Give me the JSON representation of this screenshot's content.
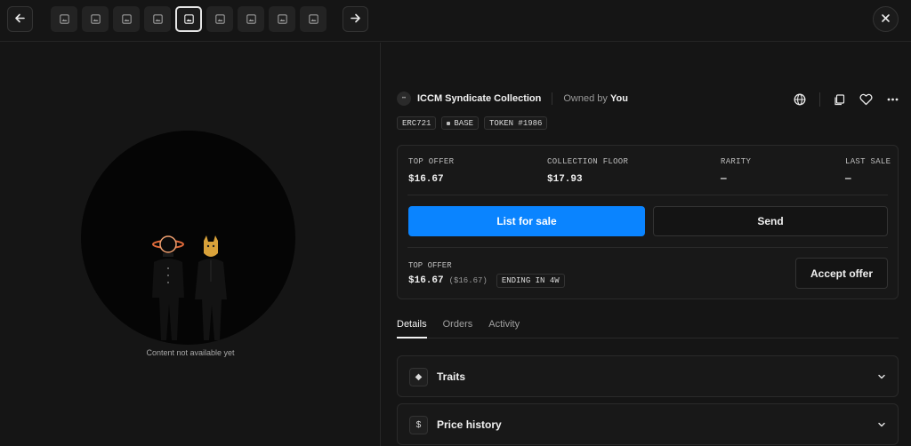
{
  "toolbar": {
    "prev_icon": "arrow-left-icon",
    "next_icon": "arrow-right-icon",
    "close_icon": "close-icon",
    "thumbnail_count": 9,
    "active_thumbnail_index": 4
  },
  "left": {
    "caption": "Content not available yet"
  },
  "header": {
    "collection_name": "ICCM Syndicate Collection",
    "owned_prefix": "Owned by",
    "owned_by": "You",
    "action_icons": [
      "globe-icon",
      "copy-icon",
      "heart-icon",
      "more-icon"
    ]
  },
  "tags": {
    "standard": "ERC721",
    "chain": "BASE",
    "token": "TOKEN #1986"
  },
  "stats": {
    "top_offer_label": "TOP OFFER",
    "top_offer_value": "$16.67",
    "floor_label": "COLLECTION FLOOR",
    "floor_value": "$17.93",
    "rarity_label": "RARITY",
    "rarity_value": "—",
    "last_sale_label": "LAST SALE",
    "last_sale_value": "—"
  },
  "actions": {
    "list_label": "List for sale",
    "send_label": "Send"
  },
  "offer": {
    "label": "TOP OFFER",
    "price": "$16.67",
    "usd": "($16.67)",
    "ending": "ENDING IN 4W",
    "accept_label": "Accept offer"
  },
  "tabs": [
    {
      "label": "Details",
      "active": true
    },
    {
      "label": "Orders",
      "active": false
    },
    {
      "label": "Activity",
      "active": false
    }
  ],
  "sections": [
    {
      "title": "Traits",
      "icon": "diamond-icon",
      "glyph": "◆"
    },
    {
      "title": "Price history",
      "icon": "dollar-icon",
      "glyph": "$"
    }
  ],
  "colors": {
    "accent": "#0a84ff",
    "background": "#151515"
  }
}
